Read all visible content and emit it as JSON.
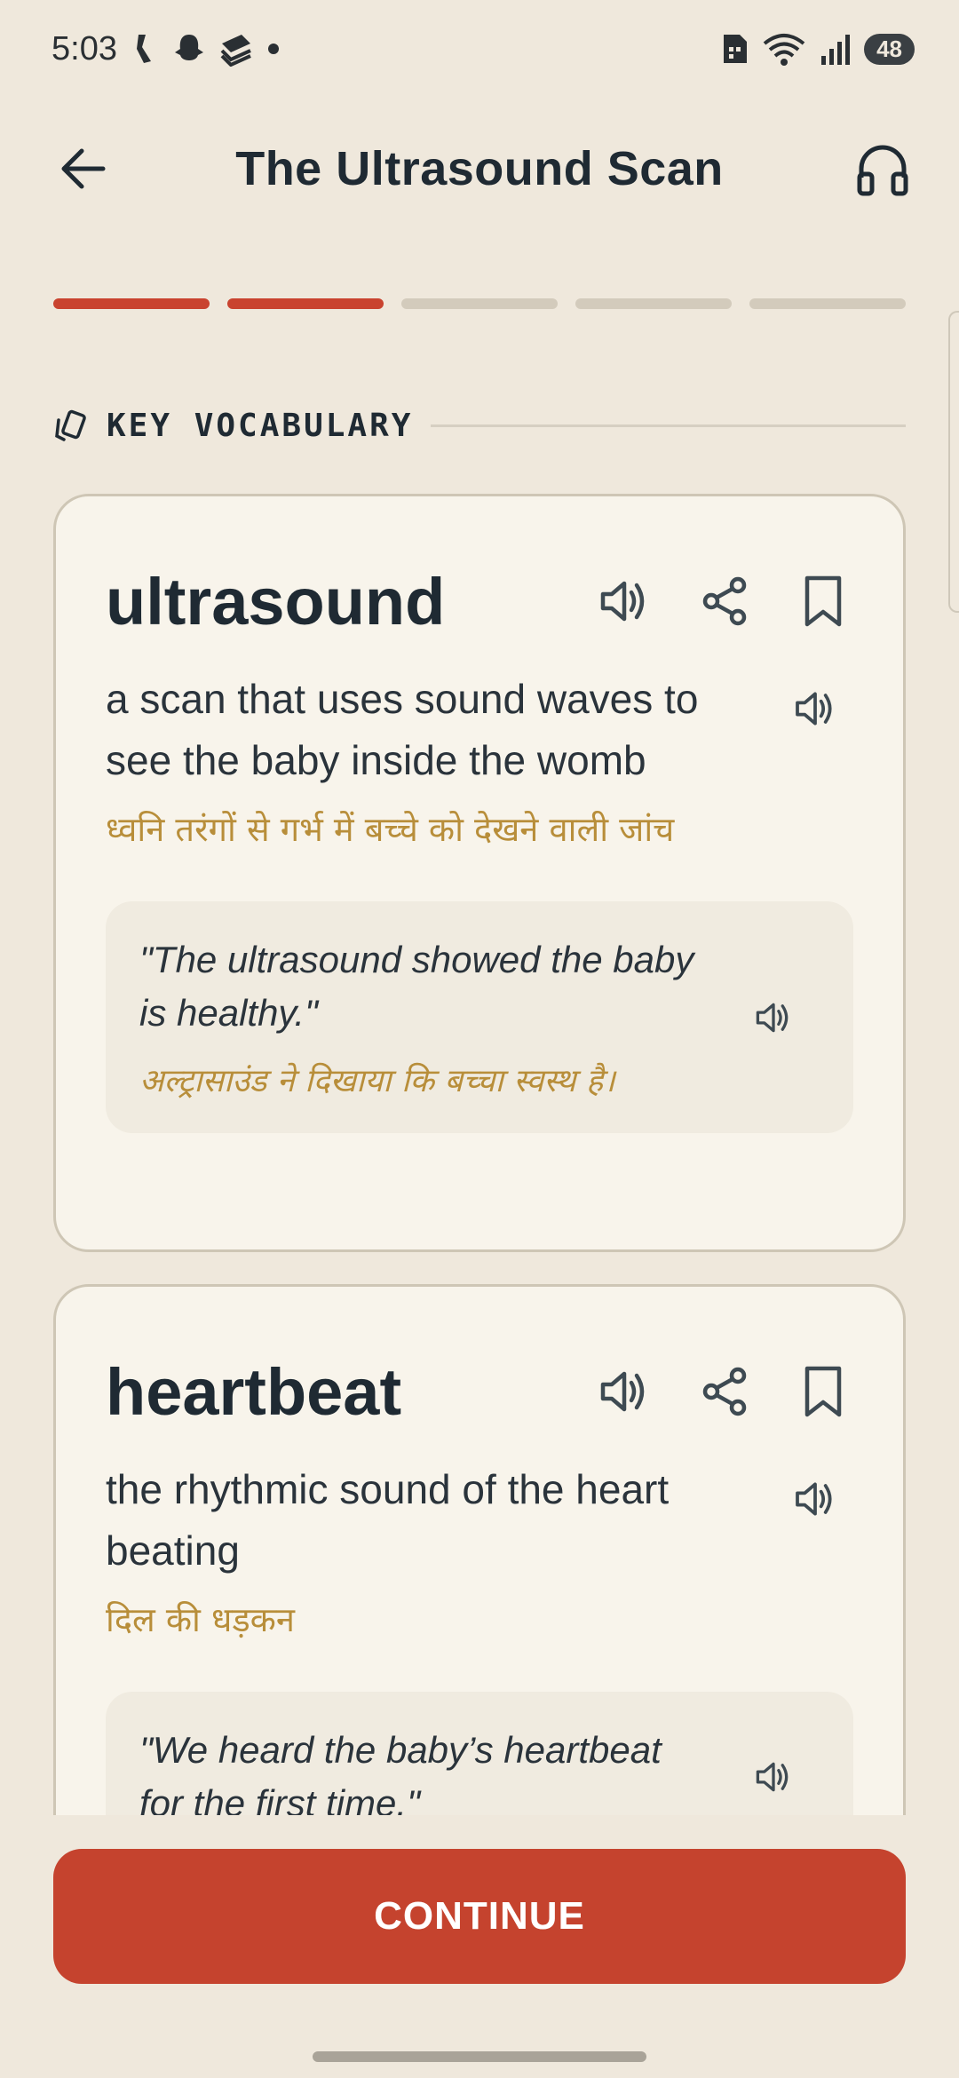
{
  "status_bar": {
    "time": "5:03",
    "battery": "48",
    "left_icons": [
      "call-icon",
      "snapchat-icon",
      "layers-icon",
      "dot-icon"
    ],
    "right_icons": [
      "sim-icon",
      "wifi-icon",
      "signal-icon",
      "battery-icon"
    ]
  },
  "header": {
    "title": "The Ultrasound Scan",
    "back_icon": "back-arrow-icon",
    "audio_icon": "headphones-icon"
  },
  "progress": {
    "total_steps": 5,
    "completed_steps": 2,
    "active_color": "#C9432F",
    "inactive_color": "#D3CBBC"
  },
  "section": {
    "label": "KEY VOCABULARY",
    "icon": "cards-icon"
  },
  "vocab": [
    {
      "word": "ultrasound",
      "definition": "a scan that uses sound waves to see the baby inside the womb",
      "translation": "ध्वनि तरंगों से गर्भ में बच्चे को देखने वाली जांच",
      "example_en": "\"The ultrasound showed the baby is healthy.\"",
      "example_hi": "अल्ट्रासाउंड ने दिखाया कि बच्चा स्वस्थ है।"
    },
    {
      "word": "heartbeat",
      "definition": "the rhythmic sound of the heart beating",
      "translation": "दिल की धड़कन",
      "example_en": "\"We heard the baby’s heartbeat for the first time.\"",
      "example_hi": ""
    }
  ],
  "footer": {
    "continue_label": "CONTINUE",
    "accent_color": "#C5432E"
  }
}
